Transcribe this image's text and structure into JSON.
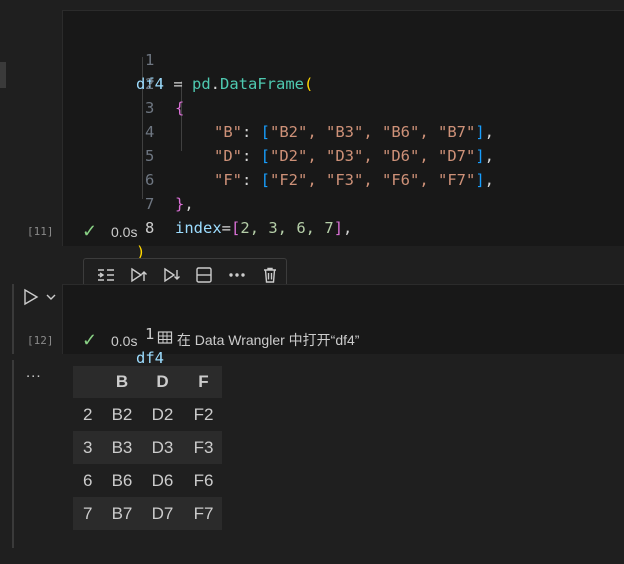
{
  "cell1": {
    "exec_count": "[11]",
    "status_time": "0.0s",
    "lines": [
      {
        "n": "1"
      },
      {
        "n": "2"
      },
      {
        "n": "3"
      },
      {
        "n": "4"
      },
      {
        "n": "5"
      },
      {
        "n": "6"
      },
      {
        "n": "7"
      },
      {
        "n": "8"
      }
    ],
    "code": {
      "l1_var": "df4",
      "l1_eq": " = ",
      "l1_mod": "pd",
      "l1_dot": ".",
      "l1_fn": "DataFrame",
      "l1_paren": "(",
      "l2_brace": "{",
      "l3_key": "\"B\"",
      "l3_colon": ": ",
      "l3_lb": "[",
      "l3_vals": "\"B2\", \"B3\", \"B6\", \"B7\"",
      "l3_rb": "]",
      "l3_comma": ",",
      "l4_key": "\"D\"",
      "l4_colon": ": ",
      "l4_lb": "[",
      "l4_vals": "\"D2\", \"D3\", \"D6\", \"D7\"",
      "l4_rb": "]",
      "l4_comma": ",",
      "l5_key": "\"F\"",
      "l5_colon": ": ",
      "l5_lb": "[",
      "l5_vals": "\"F2\", \"F3\", \"F6\", \"F7\"",
      "l5_rb": "]",
      "l5_comma": ",",
      "l6_brace": "}",
      "l6_comma": ",",
      "l7_kw": "index",
      "l7_eq": "=",
      "l7_lb": "[",
      "l7_vals": "2, 3, 6, 7",
      "l7_rb": "]",
      "l7_comma": ",",
      "l8_paren": ")"
    }
  },
  "cell2": {
    "exec_count": "[12]",
    "line_no": "1",
    "code": "df4",
    "status_time": "0.0s",
    "open_in_wrangler": "在 Data Wrangler 中打开“df4”"
  },
  "toolbar": {
    "icons": [
      "execute-above-icon",
      "run-above-icon",
      "run-below-icon",
      "split-cell-icon",
      "more-icon",
      "delete-icon"
    ]
  },
  "output": {
    "more_label": "...",
    "columns": [
      "",
      "B",
      "D",
      "F"
    ],
    "rows": [
      [
        "2",
        "B2",
        "D2",
        "F2"
      ],
      [
        "3",
        "B3",
        "D3",
        "F3"
      ],
      [
        "6",
        "B6",
        "D6",
        "F6"
      ],
      [
        "7",
        "B7",
        "D7",
        "F7"
      ]
    ]
  }
}
